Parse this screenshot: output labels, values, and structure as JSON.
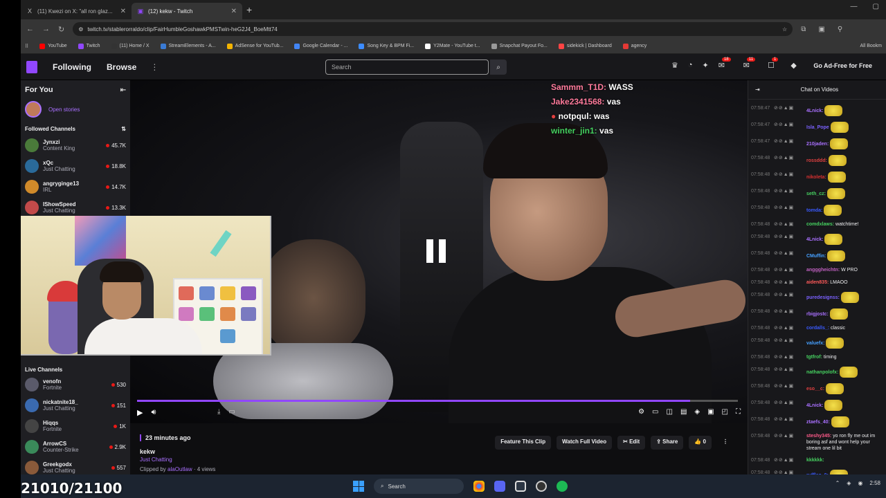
{
  "browser": {
    "tabs": [
      {
        "icon": "X",
        "label": "(11) Kwezi on X: \"all ron glaz...",
        "active": false
      },
      {
        "icon": "▣",
        "label": "(12) kekw - Twitch",
        "active": true
      }
    ],
    "url": "twitch.tv/stablerorraldo/clip/FairHumbleGoshawkPMSTwin-heG2J4_BoeMtt74",
    "bookmarks": [
      {
        "label": "YouTube",
        "color": "#ff0000"
      },
      {
        "label": "Twitch",
        "color": "#9147ff"
      },
      {
        "label": "(11) Home / X",
        "color": "#333333"
      },
      {
        "label": "StreamElements - A...",
        "color": "#3a7bd5"
      },
      {
        "label": "AdSense for YouTub...",
        "color": "#f4b400"
      },
      {
        "label": "Google Calendar - ...",
        "color": "#4285f4"
      },
      {
        "label": "Song Key & BPM Fi...",
        "color": "#3c8cff"
      },
      {
        "label": "Y2Mate - YouTube t...",
        "color": "#ffffff"
      },
      {
        "label": "Snapchat Payout Fo...",
        "color": "#999999"
      },
      {
        "label": "sidekick | Dashboard",
        "color": "#ff4444"
      },
      {
        "label": "agency",
        "color": "#e53935"
      }
    ],
    "bookmarks_right": "All Bookm"
  },
  "twitch_nav": {
    "following": "Following",
    "browse": "Browse",
    "search_placeholder": "Search",
    "ad_free": "Go Ad-Free for Free",
    "badges": [
      "18",
      "11",
      "1"
    ]
  },
  "sidebar": {
    "for_you": "For You",
    "open_stories": "Open stories",
    "followed_channels": "Followed Channels",
    "followed": [
      {
        "name": "Jynxzi",
        "game": "Content King",
        "viewers": "45.7K",
        "color": "#4a7a3a"
      },
      {
        "name": "xQc",
        "game": "Just Chatting",
        "viewers": "18.8K",
        "color": "#2a6a9a"
      },
      {
        "name": "angryginge13",
        "game": "IRL",
        "viewers": "14.7K",
        "color": "#d08a2a"
      },
      {
        "name": "IShowSpeed",
        "game": "Just Chatting",
        "viewers": "13.3K",
        "color": "#c24a4a"
      }
    ],
    "live_channels": "Live Channels",
    "live": [
      {
        "name": "venofn",
        "game": "Fortnite",
        "viewers": "530",
        "color": "#5a5a6a"
      },
      {
        "name": "nickatnite18_",
        "game": "Just Chatting",
        "viewers": "151",
        "color": "#3a6ab0"
      },
      {
        "name": "Hiqqs",
        "game": "Fortnite",
        "viewers": "1K",
        "color": "#444"
      },
      {
        "name": "ArrowCS",
        "game": "Counter-Strike",
        "viewers": "2.9K",
        "color": "#3a8a5a"
      },
      {
        "name": "Greekgodx",
        "game": "Just Chatting",
        "viewers": "557",
        "color": "#8a5a3a"
      }
    ]
  },
  "video": {
    "chat_overlay": [
      {
        "user": "Sammm_T1D:",
        "text": "WASS",
        "color": "#ff7b9c"
      },
      {
        "user": "Jake2341568:",
        "text": "vas",
        "color": "#ff7b9c"
      },
      {
        "user": "notpqul:",
        "text": "was",
        "color": "#ffffff"
      },
      {
        "user": "winter_jin1:",
        "text": "vas",
        "color": "#46d160"
      }
    ],
    "progress": 0.92
  },
  "clip": {
    "time": "23 minutes ago",
    "title": "kekw",
    "game": "Just Chatting",
    "clipped_prefix": "Clipped by",
    "clipped_by": "alaOutlaw",
    "views": "· 4 views",
    "actions": {
      "feature": "Feature This Clip",
      "watch_full": "Watch Full Video",
      "edit": "✂ Edit",
      "share": "⇪ Share",
      "likes": "👍 0"
    }
  },
  "chat": {
    "title": "Chat on Videos",
    "messages": [
      {
        "ts": "07:58:47",
        "user": "4Lnick:",
        "color": "#a970ff",
        "text": "",
        "emote": true
      },
      {
        "ts": "07:58:47",
        "user": "Isla_Pope",
        "color": "#7b61ff",
        "text": "",
        "emote": true
      },
      {
        "ts": "07:58:47",
        "user": "210jaden:",
        "color": "#a970ff",
        "text": "",
        "emote": true
      },
      {
        "ts": "07:58:48",
        "user": "rossddd:",
        "color": "#e04040",
        "text": "",
        "emote": true
      },
      {
        "ts": "07:58:48",
        "user": "nikoleta:",
        "color": "#d93030",
        "text": "",
        "emote": true
      },
      {
        "ts": "07:58:48",
        "user": "seth_cz:",
        "color": "#46d160",
        "text": "",
        "emote": true
      },
      {
        "ts": "07:58:48",
        "user": "tomda:",
        "color": "#3a5aff",
        "text": "",
        "emote": true
      },
      {
        "ts": "07:58:48",
        "user": "comdxlaws:",
        "color": "#46d160",
        "text": "watchtime!",
        "emote": false
      },
      {
        "ts": "07:58:48",
        "user": "4Lnick:",
        "color": "#a970ff",
        "text": "",
        "emote": true
      },
      {
        "ts": "07:58:48",
        "user": "CMuffin:",
        "color": "#46a0ff",
        "text": "",
        "emote": true
      },
      {
        "ts": "07:58:48",
        "user": "angggheichtn:",
        "color": "#c060c0",
        "text": "W PRO",
        "emote": false
      },
      {
        "ts": "07:58:48",
        "user": "aiden835:",
        "color": "#ff5a5a",
        "text": "LMAOO",
        "emote": false
      },
      {
        "ts": "07:58:48",
        "user": "puredesignss:",
        "color": "#7b61ff",
        "text": "",
        "emote": true
      },
      {
        "ts": "07:58:48",
        "user": "rbigjostc:",
        "color": "#a970ff",
        "text": "",
        "emote": true
      },
      {
        "ts": "07:58:48",
        "user": "cordalls_:",
        "color": "#3a5aff",
        "text": "classic",
        "emote": false
      },
      {
        "ts": "07:58:48",
        "user": "valuefx:",
        "color": "#46a0ff",
        "text": "",
        "emote": true
      },
      {
        "ts": "07:58:48",
        "user": "tgtfrof:",
        "color": "#46d160",
        "text": "timing",
        "emote": false
      },
      {
        "ts": "07:58:48",
        "user": "nathanpolofx:",
        "color": "#46d160",
        "text": "",
        "emote": true
      },
      {
        "ts": "07:58:48",
        "user": "eso__c:",
        "color": "#e04040",
        "text": "",
        "emote": true
      },
      {
        "ts": "07:58:48",
        "user": "4Lnick:",
        "color": "#a970ff",
        "text": "",
        "emote": true
      },
      {
        "ts": "07:58:48",
        "user": "ztaefs_40:",
        "color": "#a970ff",
        "text": "",
        "emote": true
      },
      {
        "ts": "07:58:48",
        "user": "steshy345:",
        "color": "#ff5a8a",
        "text": "yo ron fly me out im boring asf and wont help your stream one lil bit",
        "emote": false
      },
      {
        "ts": "07:58:48",
        "user": "kkkkkk:",
        "color": "#46d160",
        "text": "",
        "emote": false
      },
      {
        "ts": "07:58:48",
        "user": "ruffleo_0:",
        "color": "#3a5aff",
        "text": "",
        "emote": true
      },
      {
        "ts": "07:58:48",
        "user": "itz_Chase:",
        "color": "#46d160",
        "text": "",
        "emote": true
      }
    ]
  },
  "taskbar": {
    "search": "Search",
    "time": "2:58"
  },
  "counter": "21010/21100"
}
